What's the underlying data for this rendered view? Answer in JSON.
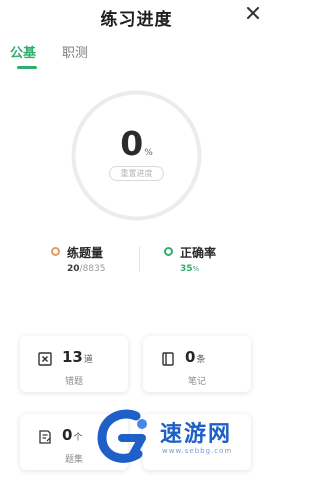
{
  "header": {
    "title": "练习进度",
    "close_icon": "close-icon"
  },
  "tabs": [
    {
      "label": "公基",
      "active": true
    },
    {
      "label": "职测",
      "active": false
    }
  ],
  "progress": {
    "value": "0",
    "unit": "%",
    "reset_label": "重置进度"
  },
  "stats": {
    "practiced": {
      "label": "练题量",
      "done": "20",
      "total": "/8835"
    },
    "accuracy": {
      "label": "正确率",
      "value": "35",
      "unit": "%"
    }
  },
  "cards": [
    {
      "count": "13",
      "unit": "道",
      "caption": "错题",
      "icon": "wrong-question-icon"
    },
    {
      "count": "0",
      "unit": "条",
      "caption": "笔记",
      "icon": "notebook-icon"
    },
    {
      "count": "0",
      "unit": "个",
      "caption": "题集",
      "icon": "question-set-icon"
    },
    {
      "count": "",
      "unit": "",
      "caption": "",
      "icon": ""
    }
  ],
  "watermark": {
    "text": "速游网",
    "url": "www.sebbg.com"
  },
  "colors": {
    "accent": "#2fae6d",
    "orange": "#e59a5f",
    "watermark_blue": "#1f5fc8"
  }
}
